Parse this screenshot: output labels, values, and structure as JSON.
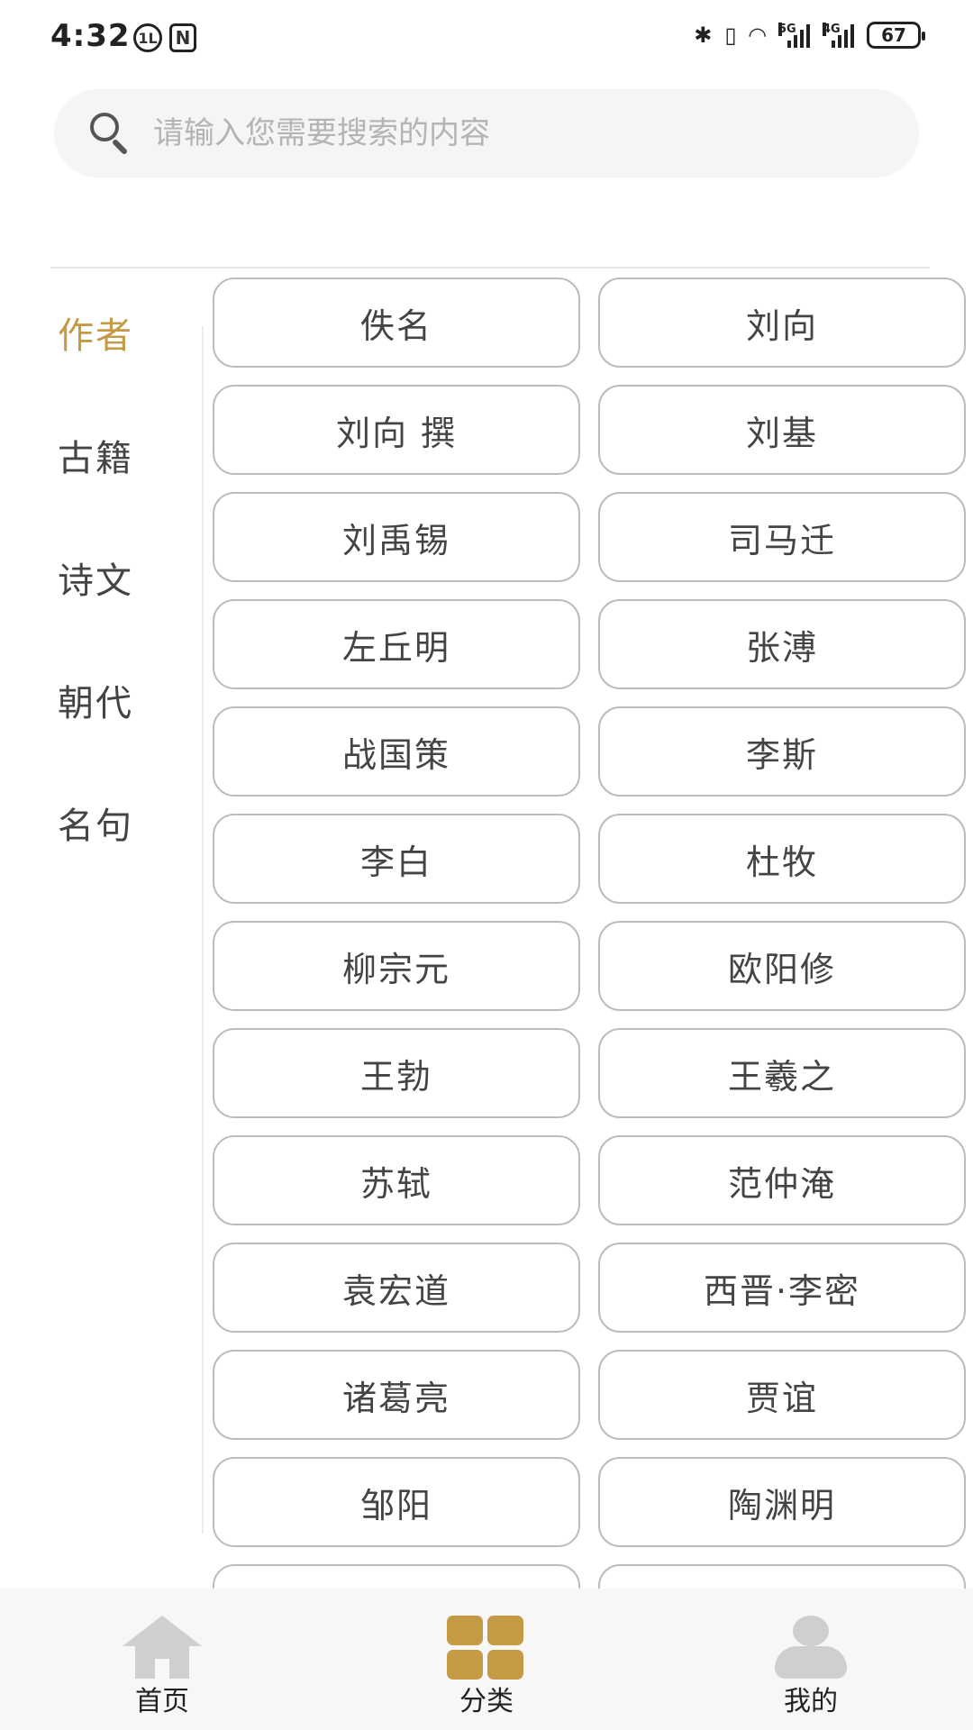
{
  "status_bar": {
    "time": "4:32",
    "icon_circle": "1L",
    "icon_nfc": "N",
    "net_5g": "5G",
    "net_4g": "4G",
    "battery": "67"
  },
  "search": {
    "placeholder": "请输入您需要搜索的内容",
    "value": ""
  },
  "categories": [
    {
      "label": "作者",
      "active": true
    },
    {
      "label": "古籍",
      "active": false
    },
    {
      "label": "诗文",
      "active": false
    },
    {
      "label": "朝代",
      "active": false
    },
    {
      "label": "名句",
      "active": false
    }
  ],
  "authors": [
    "佚名",
    "刘向",
    "刘向 撰",
    "刘基",
    "刘禹锡",
    "司马迁",
    "左丘明",
    "张溥",
    "战国策",
    "李斯",
    "李白",
    "杜牧",
    "柳宗元",
    "欧阳修",
    "王勃",
    "王羲之",
    "苏轼",
    "范仲淹",
    "袁宏道",
    "西晋·李密",
    "诸葛亮",
    "贾谊",
    "邹阳",
    "陶渊明",
    "",
    ""
  ],
  "bottom_nav": [
    {
      "label": "首页",
      "icon": "home-icon",
      "active": false
    },
    {
      "label": "分类",
      "icon": "category-grid-icon",
      "active": true
    },
    {
      "label": "我的",
      "icon": "user-icon",
      "active": false
    }
  ],
  "colors": {
    "accent": "#c49a45",
    "inactive_icon": "#cfcfcf",
    "button_border": "#bcbcbc"
  }
}
